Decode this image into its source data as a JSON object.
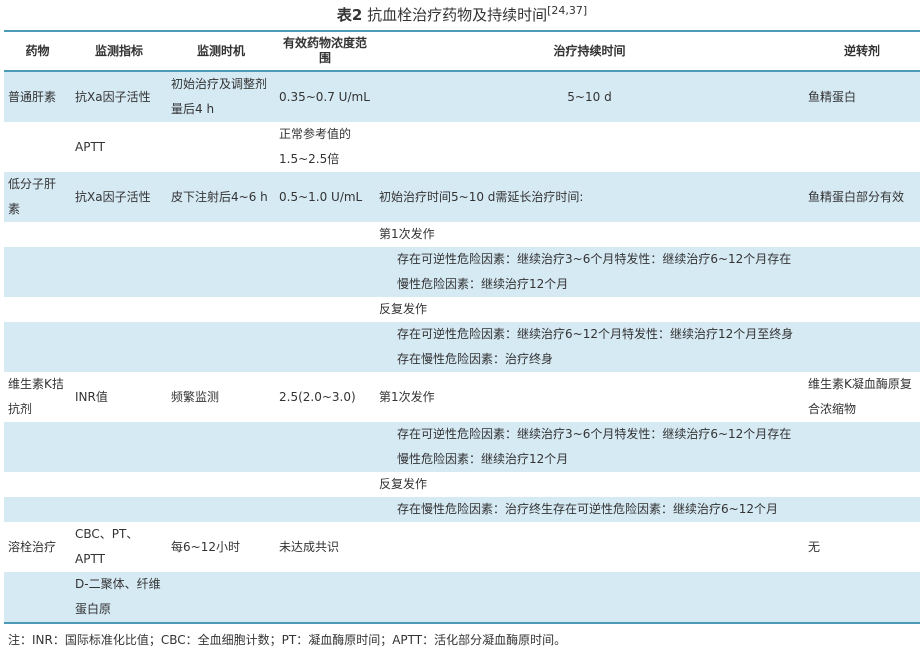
{
  "caption": {
    "label": "表2",
    "title": "抗血栓治疗药物及持续时间",
    "ref": "[24,37]"
  },
  "header": {
    "drug": "药物",
    "indicator": "监测指标",
    "timing": "监测时机",
    "range": "有效药物浓度范围",
    "duration": "治疗持续时间",
    "reversal": "逆转剂"
  },
  "rows": {
    "r1": {
      "drug": "普通肝素",
      "indicator": "抗Xa因子活性",
      "timing": "初始治疗及调整剂量后4 h",
      "range": "0.35~0.7 U/mL",
      "duration": "5~10 d",
      "reversal": "鱼精蛋白"
    },
    "r2": {
      "indicator": "APTT",
      "range": "正常参考值的1.5~2.5倍"
    },
    "r3": {
      "drug": "低分子肝素",
      "indicator": "抗Xa因子活性",
      "timing": "皮下注射后4~6 h",
      "range": "0.5~1.0 U/mL",
      "duration": "初始治疗时间5~10 d需延长治疗时间:",
      "reversal": "鱼精蛋白部分有效"
    },
    "r4": {
      "duration": "第1次发作"
    },
    "r5": {
      "duration": "存在可逆性危险因素：继续治疗3~6个月特发性：继续治疗6~12个月存在慢性危险因素：继续治疗12个月"
    },
    "r6": {
      "duration": "反复发作"
    },
    "r7": {
      "duration": "存在可逆性危险因素：继续治疗6~12个月特发性：继续治疗12个月至终身存在慢性危险因素：治疗终身"
    },
    "r8": {
      "drug": "维生素K拮抗剂",
      "indicator": "INR值",
      "timing": "频繁监测",
      "range": "2.5(2.0~3.0)",
      "duration": "第1次发作",
      "reversal": "维生素K凝血酶原复合浓缩物"
    },
    "r9": {
      "duration": "存在可逆性危险因素：继续治疗3~6个月特发性：继续治疗6~12个月存在慢性危险因素：继续治疗12个月"
    },
    "r10": {
      "duration": "反复发作"
    },
    "r11": {
      "duration": "存在慢性危险因素：治疗终生存在可逆性危险因素：继续治疗6~12个月"
    },
    "r12": {
      "drug": "溶栓治疗",
      "indicator": "CBC、PT、APTT",
      "timing": "每6~12小时",
      "range": "未达成共识",
      "reversal": "无"
    },
    "r13": {
      "indicator": "D-二聚体、纤维蛋白原"
    }
  },
  "footnote": "注：INR：国际标准化比值；CBC：全血细胞计数；PT：凝血酶原时间；APTT：活化部分凝血酶原时间。",
  "colors": {
    "border": "#4a9ab8",
    "stripe": "#d6eaf4"
  }
}
